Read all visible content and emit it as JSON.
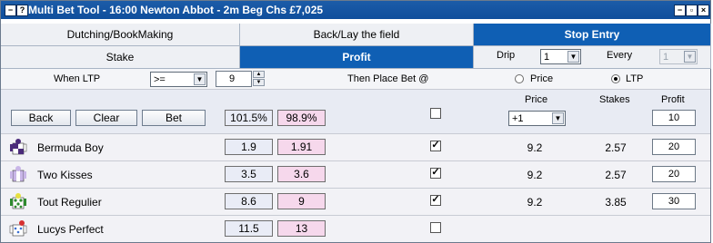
{
  "window": {
    "title": "Multi Bet Tool - 16:00  Newton Abbot - 2m Beg Chs  £7,025"
  },
  "tabs_top": [
    {
      "label": "Dutching/BookMaking",
      "active": false
    },
    {
      "label": "Back/Lay the field",
      "active": false
    },
    {
      "label": "Stop Entry",
      "active": true
    }
  ],
  "tabs_second": [
    {
      "label": "Stake",
      "active": false
    },
    {
      "label": "Profit",
      "active": true
    }
  ],
  "drip": {
    "label": "Drip",
    "value": "1"
  },
  "every": {
    "label": "Every",
    "value": "1"
  },
  "when_ltp": {
    "label": "When LTP",
    "operator": ">=",
    "value": "9",
    "place_label": "Then Place Bet @",
    "options": [
      {
        "label": "Price",
        "selected": false
      },
      {
        "label": "LTP",
        "selected": true
      }
    ]
  },
  "actions": {
    "back": "Back",
    "clear": "Clear",
    "bet": "Bet",
    "back_book": "101.5%",
    "lay_book": "98.9%"
  },
  "columns": {
    "price": "Price",
    "stakes": "Stakes",
    "profit": "Profit"
  },
  "header_row": {
    "price_offset": "+1",
    "profit": "10",
    "checked": false
  },
  "runners": [
    {
      "name": "Bermuda Boy",
      "back": "1.9",
      "lay": "1.91",
      "checked": true,
      "price": "9.2",
      "stakes": "2.57",
      "profit": "20",
      "silk": "purple-white-quarters"
    },
    {
      "name": "Two Kisses",
      "back": "3.5",
      "lay": "3.6",
      "checked": true,
      "price": "9.2",
      "stakes": "2.57",
      "profit": "20",
      "silk": "lilac-white"
    },
    {
      "name": "Tout Regulier",
      "back": "8.6",
      "lay": "9",
      "checked": true,
      "price": "9.2",
      "stakes": "3.85",
      "profit": "30",
      "silk": "green-white-spots"
    },
    {
      "name": "Lucys Perfect",
      "back": "11.5",
      "lay": "13",
      "checked": false,
      "price": "",
      "stakes": "",
      "profit": "",
      "silk": "white-blue-red"
    }
  ],
  "colors": {
    "titlebar": "#0f4e9c",
    "active_tab": "#0f5fb4",
    "lay_cell": "#f6d8ec"
  }
}
